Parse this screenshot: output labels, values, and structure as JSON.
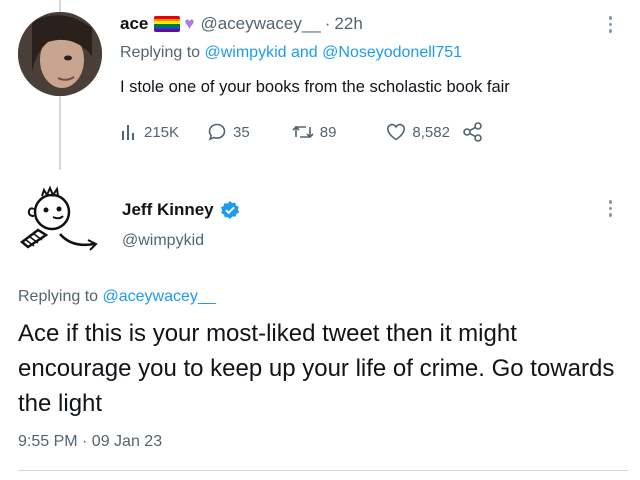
{
  "colors": {
    "link": "#1d9bf0",
    "muted": "#536471",
    "verified": "#1d9bf0",
    "heart_emoji": "#a980d8"
  },
  "reply_tweet": {
    "name": "ace",
    "emoji_icons": [
      "pride-flag-icon",
      "purple-heart-icon"
    ],
    "handle": "@aceywacey__",
    "separator": "·",
    "time": "22h",
    "replying_prefix": "Replying to",
    "replying_user_1": "@wimpykid",
    "replying_and": "and",
    "replying_user_2": "@Noseyodonell751",
    "text": "I stole one of your books from the scholastic book fair",
    "stats": {
      "views": "215K",
      "replies": "35",
      "retweets": "89",
      "likes": "8,582"
    }
  },
  "main_tweet": {
    "name": "Jeff Kinney",
    "verified": true,
    "handle": "@wimpykid",
    "replying_prefix": "Replying to",
    "replying_user": "@aceywacey__",
    "text": "Ace if this is your most-liked tweet then it might encourage you to keep up your life of crime. Go towards the light",
    "timestamp": "9:55 PM · 09 Jan 23"
  }
}
